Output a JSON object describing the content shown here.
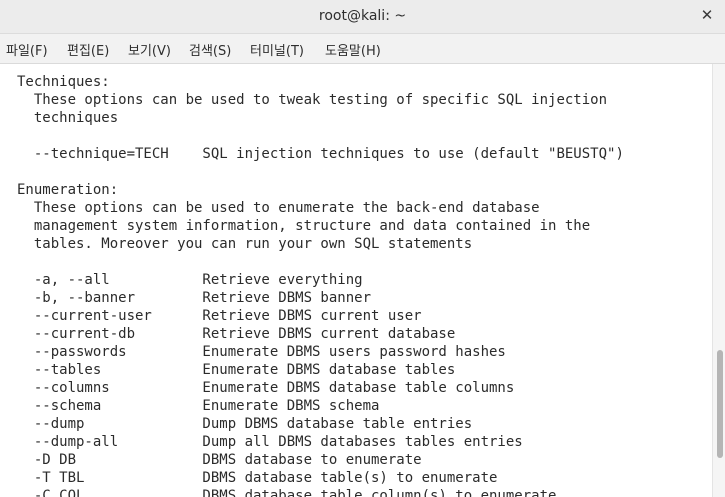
{
  "window": {
    "title": "root@kali: ~"
  },
  "menu": [
    "파일(F)",
    "편집(E)",
    "보기(V)",
    "검색(S)",
    "터미널(T)",
    "도움말(H)"
  ],
  "terminal_lines": [
    "Techniques:",
    "  These options can be used to tweak testing of specific SQL injection",
    "  techniques",
    "",
    "  --technique=TECH    SQL injection techniques to use (default \"BEUSTQ\")",
    "",
    "Enumeration:",
    "  These options can be used to enumerate the back-end database",
    "  management system information, structure and data contained in the",
    "  tables. Moreover you can run your own SQL statements",
    "",
    "  -a, --all           Retrieve everything",
    "  -b, --banner        Retrieve DBMS banner",
    "  --current-user      Retrieve DBMS current user",
    "  --current-db        Retrieve DBMS current database",
    "  --passwords         Enumerate DBMS users password hashes",
    "  --tables            Enumerate DBMS database tables",
    "  --columns           Enumerate DBMS database table columns",
    "  --schema            Enumerate DBMS schema",
    "  --dump              Dump DBMS database table entries",
    "  --dump-all          Dump all DBMS databases tables entries",
    "  -D DB               DBMS database to enumerate",
    "  -T TBL              DBMS database table(s) to enumerate",
    "  -C COL              DBMS database table column(s) to enumerate"
  ]
}
